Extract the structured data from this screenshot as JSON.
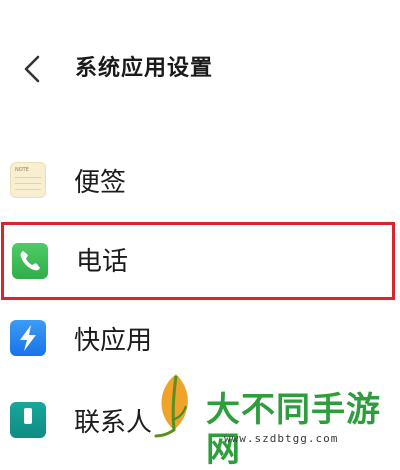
{
  "header": {
    "back_icon": "chevron-left-icon",
    "title": "系统应用设置"
  },
  "list": {
    "items": [
      {
        "label": "便签",
        "icon": "notes-app-icon",
        "icon_tag": "NOTE"
      },
      {
        "label": "电话",
        "icon": "phone-app-icon",
        "highlighted": true,
        "highlight_color": "#d9252c"
      },
      {
        "label": "快应用",
        "icon": "quick-app-icon"
      },
      {
        "label": "联系人",
        "icon": "contacts-app-icon"
      }
    ]
  },
  "watermark": {
    "brand": "大不同手游网",
    "url": "www.szdbtgg.com",
    "color": "#2e9e3c"
  }
}
